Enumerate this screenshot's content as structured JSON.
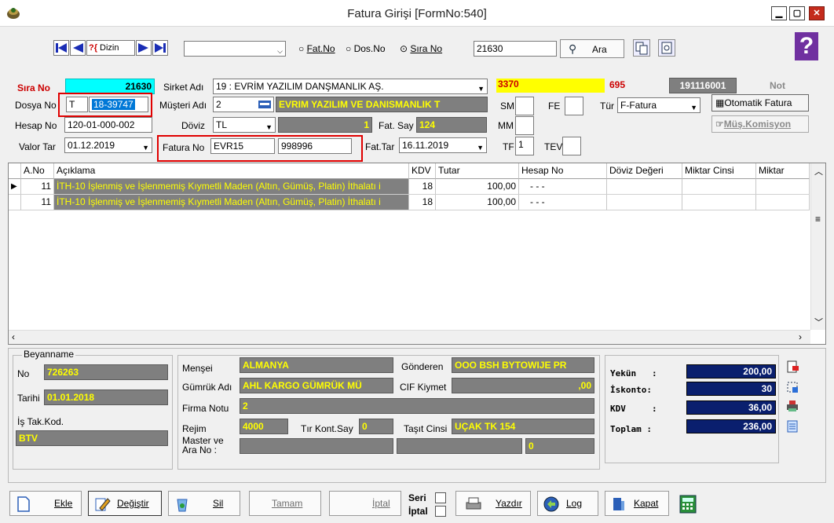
{
  "window": {
    "title": "Fatura Girişi [FormNo:540]"
  },
  "toolbar": {
    "dizin_label": "Dizin",
    "search_mode_options": [
      "Fat.No",
      "Dos.No",
      "Sıra No"
    ],
    "search_value": "21630",
    "search_button": "Ara"
  },
  "header": {
    "sira_no_label": "Sıra No",
    "sira_no": "21630",
    "sirket_adi_label": "Sirket Adı",
    "sirket_adi": "19 : EVRİM YAZILIM DANŞMANLIK AŞ.",
    "code_yellow": "3370",
    "code_red": "695",
    "code_dark": "191116001",
    "not_label": "Not",
    "dosya_no_label": "Dosya No",
    "dosya_prefix": "T",
    "dosya_no": "18-39747",
    "musteri_adi_label": "Müşteri Adı",
    "musteri_kod": "2",
    "musteri_adi": "EVRIM YAZILIM VE DANISMANLIK T",
    "sm_label": "SM",
    "fe_label": "FE",
    "tur_label": "Tür",
    "tur_value": "F-Fatura",
    "otomatik_fatura": "Otomatik Fatura",
    "hesap_no_label": "Hesap No",
    "hesap_no": "120-01-000-002",
    "doviz_label": "Döviz",
    "doviz": "TL",
    "doviz_value": "1",
    "fat_say_label": "Fat. Say",
    "fat_say": "124",
    "mm_label": "MM",
    "mus_komisyon": "Müş.Komisyon",
    "valor_tar_label": "Valor Tar",
    "valor_tar": "01.12.2019",
    "fatura_no_label": "Fatura No",
    "fatura_no": "EVR15",
    "fatura_no2": "998996",
    "fat_tar_label": "Fat.Tar",
    "fat_tar": "16.11.2019",
    "tf_label": "TF",
    "tf_value": "1",
    "tev_label": "TEV"
  },
  "grid": {
    "columns": [
      "A.No",
      "Açıklama",
      "KDV",
      "Tutar",
      "Hesap No",
      "Döviz Değeri",
      "Miktar Cinsi",
      "Miktar"
    ],
    "rows": [
      {
        "ano": "11",
        "aciklama": "İTH-10 İşlenmiş ve İşlenmemiş Kıymetli Maden (Altın, Gümüş, Platin) İthalatı i",
        "kdv": "18",
        "tutar": "100,00",
        "hesap": "- - -"
      },
      {
        "ano": "11",
        "aciklama": "İTH-10 İşlenmiş ve İşlenmemiş Kıymetli Maden (Altın, Gümüş, Platin) İthalatı i",
        "kdv": "18",
        "tutar": "100,00",
        "hesap": "- - -"
      }
    ]
  },
  "beyanname": {
    "title": "Beyanname",
    "no_label": "No",
    "no": "726263",
    "tarihi_label": "Tarihi",
    "tarihi": "01.01.2018",
    "is_tak_label": "İş Tak.Kod.",
    "is_tak": "BTV"
  },
  "details": {
    "mensei_label": "Menşei",
    "mensei": "ALMANYA",
    "gonderen_label": "Gönderen",
    "gonderen": "OOO BSH BYTOWIJE PR",
    "gumruk_label": "Gümrük Adı",
    "gumruk": "AHL KARGO GÜMRÜK MÜ",
    "cif_label": "CIF Kiymet",
    "cif": ",00",
    "firma_notu_label": "Firma Notu",
    "firma_notu": "2",
    "rejim_label": "Rejim",
    "rejim": "4000",
    "tir_label": "Tır Kont.Say",
    "tir": "0",
    "tasit_label": "Taşıt Cinsi",
    "tasit": "UÇAK TK 154",
    "master_label": "Master ve Ara No :",
    "master_val": "0"
  },
  "totals": {
    "yekun_label": "Yekün",
    "yekun": "200,00",
    "iskonto_label": "İskonto",
    "iskonto": "30",
    "kdv_label": "KDV",
    "kdv": "36,00",
    "toplam_label": "Toplam",
    "toplam": "236,00"
  },
  "buttons": {
    "ekle": "Ekle",
    "degistir": "Değiştir",
    "sil": "Sil",
    "tamam": "Tamam",
    "iptal": "İptal",
    "seri": "Seri",
    "iptal2": "İptal",
    "yazdir": "Yazdır",
    "log": "Log",
    "kapat": "Kapat"
  }
}
